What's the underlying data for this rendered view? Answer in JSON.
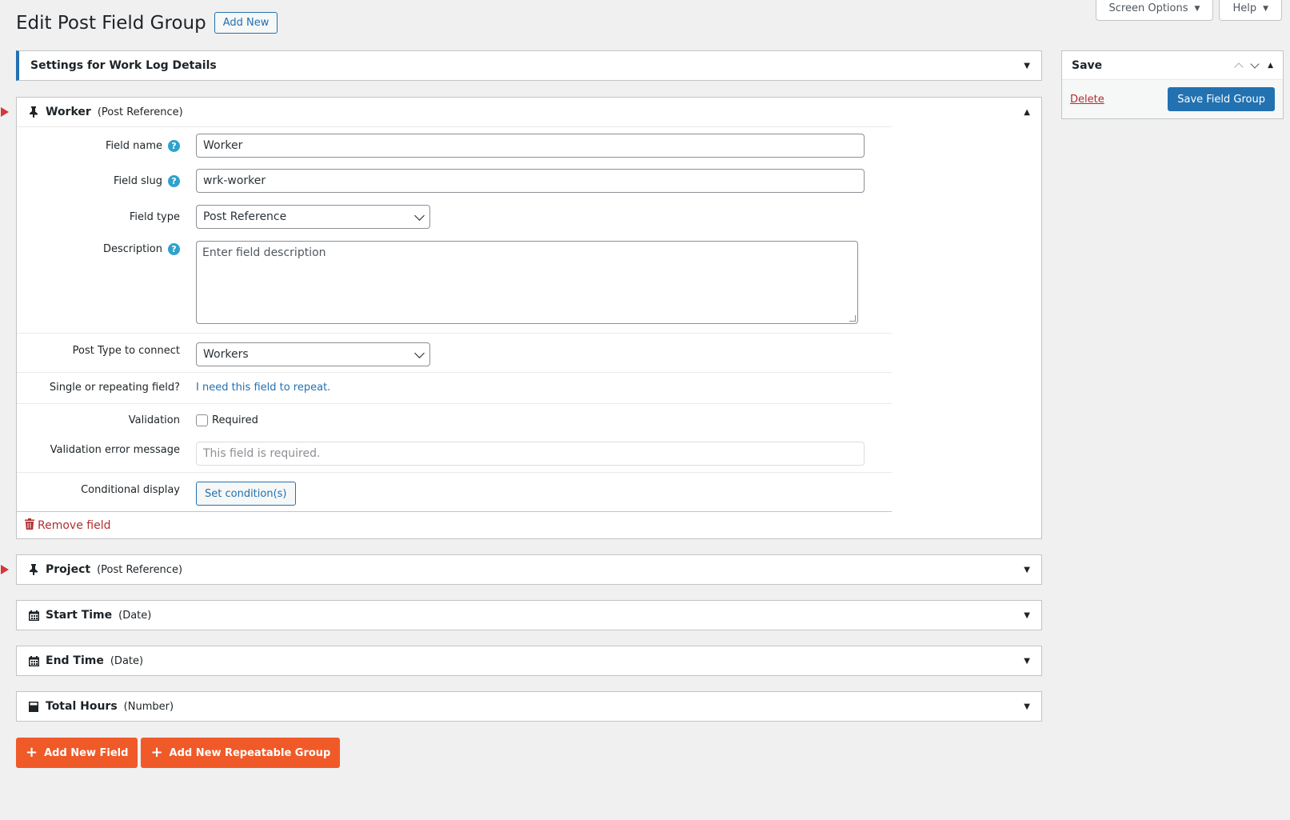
{
  "screen_tabs": {
    "screen_options": "Screen Options",
    "help": "Help"
  },
  "header": {
    "title": "Edit Post Field Group",
    "add_new": "Add New"
  },
  "settings_box": {
    "title": "Settings for Work Log Details"
  },
  "worker_field": {
    "name": "Worker",
    "type": "(Post Reference)",
    "labels": {
      "field_name": "Field name",
      "field_slug": "Field slug",
      "field_type": "Field type",
      "description": "Description",
      "post_type": "Post Type to connect",
      "single_repeating": "Single or repeating field?",
      "validation": "Validation",
      "validation_error": "Validation error message",
      "conditional": "Conditional display"
    },
    "values": {
      "field_name": "Worker",
      "field_slug": "wrk-worker",
      "field_type": "Post Reference",
      "description_placeholder": "Enter field description",
      "post_type": "Workers",
      "repeat_link": "I need this field to repeat.",
      "required_label": "Required",
      "validation_placeholder": "This field is required.",
      "set_condition": "Set condition(s)"
    },
    "remove": "Remove field"
  },
  "collapsed_fields": [
    {
      "name": "Project",
      "type": "(Post Reference)",
      "icon": "pin-icon"
    },
    {
      "name": "Start Time",
      "type": "(Date)",
      "icon": "calendar-icon"
    },
    {
      "name": "End Time",
      "type": "(Date)",
      "icon": "calendar-icon"
    },
    {
      "name": "Total Hours",
      "type": "(Number)",
      "icon": "calculator-icon"
    }
  ],
  "buttons": {
    "add_field": "Add New Field",
    "add_group": "Add New Repeatable Group"
  },
  "save_box": {
    "title": "Save",
    "delete": "Delete",
    "save": "Save Field Group"
  },
  "colors": {
    "accent": "#2271b1",
    "orange": "#f05a28",
    "danger": "#b32d2e",
    "help": "#2ea2cc"
  }
}
